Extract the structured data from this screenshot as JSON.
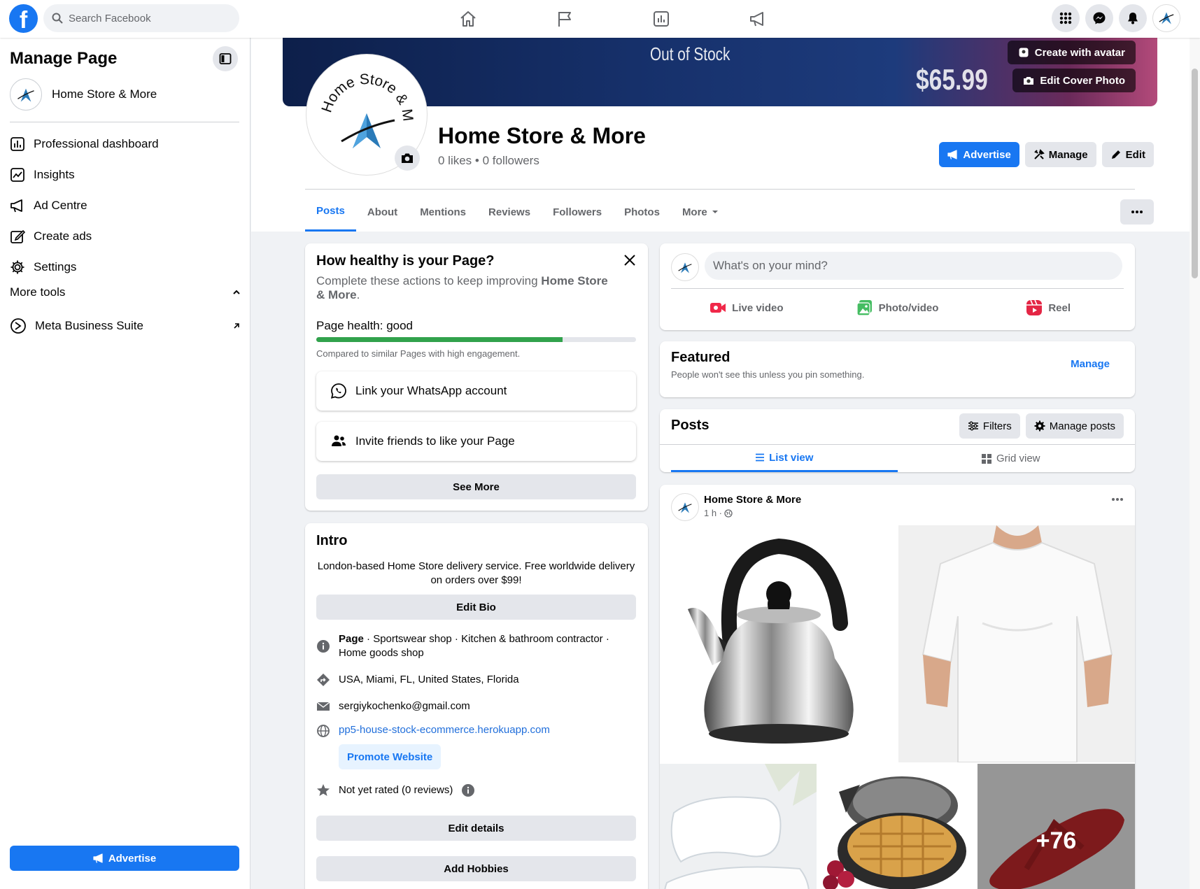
{
  "topbar": {
    "logo": "f",
    "search_placeholder": "Search Facebook",
    "nav_icons": [
      "home-icon",
      "flag-icon",
      "chart-icon",
      "megaphone-icon"
    ],
    "right_icons": [
      "menu-grid-icon",
      "messenger-icon",
      "bell-icon",
      "avatar"
    ]
  },
  "sidebar": {
    "title": "Manage Page",
    "page_name": "Home Store & More",
    "items": [
      {
        "label": "Professional dashboard",
        "icon": "dashboard-icon"
      },
      {
        "label": "Insights",
        "icon": "insights-icon"
      },
      {
        "label": "Ad Centre",
        "icon": "megaphone-icon"
      },
      {
        "label": "Create ads",
        "icon": "edit-icon"
      },
      {
        "label": "Settings",
        "icon": "gear-icon"
      }
    ],
    "more_tools": "More tools",
    "meta_business_suite": "Meta Business Suite",
    "advertise": "Advertise"
  },
  "header": {
    "cover_text_1": "Out of Stock",
    "cover_text_2": "$65.99",
    "create_avatar": "Create with avatar",
    "edit_cover": "Edit Cover Photo",
    "logo_text": "Home Store & More",
    "page_name": "Home Store & More",
    "stats": "0 likes • 0 followers",
    "advertise": "Advertise",
    "manage": "Manage",
    "edit": "Edit",
    "tabs": [
      "Posts",
      "About",
      "Mentions",
      "Reviews",
      "Followers",
      "Photos",
      "More"
    ]
  },
  "health": {
    "title": "How healthy is your Page?",
    "desc_prefix": "Complete these actions to keep improving ",
    "desc_page": "Home Store & More",
    "desc_suffix": ".",
    "health_label": "Page health: good",
    "progress": 0.77,
    "compared": "Compared to similar Pages with high engagement.",
    "whatsapp": "Link your WhatsApp account",
    "invite": "Invite friends to like your Page",
    "see_more": "See More"
  },
  "intro": {
    "title": "Intro",
    "bio": "London-based Home Store delivery service. Free worldwide delivery on orders over $99!",
    "edit_bio": "Edit Bio",
    "category_prefix": "Page",
    "category": " · Sportswear shop · Kitchen & bathroom contractor · Home goods shop",
    "location": "USA, Miami, FL, United States, Florida",
    "email": "sergiykochenko@gmail.com",
    "website": "pp5-house-stock-ecommerce.herokuapp.com",
    "promote": "Promote Website",
    "rating": "Not yet rated (0 reviews)",
    "edit_details": "Edit details",
    "add_hobbies": "Add Hobbies"
  },
  "composer": {
    "placeholder": "What's on your mind?",
    "live": "Live video",
    "photo": "Photo/video",
    "reel": "Reel"
  },
  "featured": {
    "title": "Featured",
    "subtitle": "People won't see this unless you pin something.",
    "manage": "Manage"
  },
  "posts": {
    "title": "Posts",
    "filters": "Filters",
    "manage_posts": "Manage posts",
    "list_view": "List view",
    "grid_view": "Grid view"
  },
  "post": {
    "author": "Home Store & More",
    "time": "1 h ·",
    "more_count": "+76"
  },
  "colors": {
    "brand": "#1877f2",
    "health_green": "#31a24c",
    "live_red": "#f02849",
    "photo_green": "#45bd62",
    "reel_pink": "#e42645"
  }
}
